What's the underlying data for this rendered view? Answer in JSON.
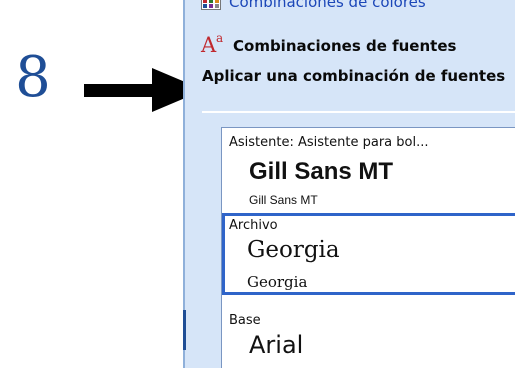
{
  "annotation": {
    "step_number": "8"
  },
  "task_pane": {
    "partial_item": {
      "label": "Combinaciones de colores",
      "icon": "color-scheme-icon"
    },
    "font_schemes_link": {
      "label": "Combinaciones de fuentes",
      "icon": "font-scheme-icon",
      "icon_text": "A",
      "icon_superscript": "a"
    },
    "section_title": "Aplicar una combinación de fuentes",
    "font_schemes": [
      {
        "category": "Asistente: Asistente para bol...",
        "major_font": "Gill Sans MT",
        "minor_font": "Gill Sans MT",
        "selected": false
      },
      {
        "category": "Archivo",
        "major_font": "Georgia",
        "minor_font": "Georgia",
        "selected": true
      },
      {
        "category": "Base",
        "major_font": "Arial",
        "minor_font": "",
        "selected": false
      }
    ]
  },
  "colors": {
    "step_number": "#1f4e96",
    "pane_background": "#d6e5f8",
    "selection_border": "#2f64c9",
    "font_icon": "#c0282e",
    "link_text": "#1c47b8"
  }
}
